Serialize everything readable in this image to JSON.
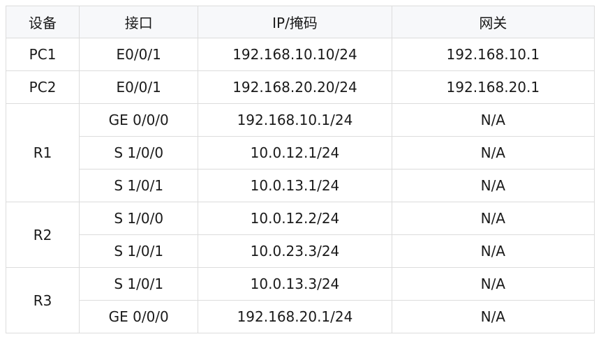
{
  "table": {
    "headers": {
      "device": "设备",
      "interface": "接口",
      "ip_mask": "IP/掩码",
      "gateway": "网关"
    },
    "groups": [
      {
        "device": "PC1",
        "rows": [
          {
            "interface": "E0/0/1",
            "ip": "192.168.10.10/24",
            "gateway": "192.168.10.1"
          }
        ]
      },
      {
        "device": "PC2",
        "rows": [
          {
            "interface": "E0/0/1",
            "ip": "192.168.20.20/24",
            "gateway": "192.168.20.1"
          }
        ]
      },
      {
        "device": "R1",
        "rows": [
          {
            "interface": "GE 0/0/0",
            "ip": "192.168.10.1/24",
            "gateway": "N/A"
          },
          {
            "interface": "S 1/0/0",
            "ip": "10.0.12.1/24",
            "gateway": "N/A"
          },
          {
            "interface": "S 1/0/1",
            "ip": "10.0.13.1/24",
            "gateway": "N/A"
          }
        ]
      },
      {
        "device": "R2",
        "rows": [
          {
            "interface": "S 1/0/0",
            "ip": "10.0.12.2/24",
            "gateway": "N/A"
          },
          {
            "interface": "S 1/0/1",
            "ip": "10.0.23.3/24",
            "gateway": "N/A"
          }
        ]
      },
      {
        "device": "R3",
        "rows": [
          {
            "interface": "S 1/0/1",
            "ip": "10.0.13.3/24",
            "gateway": "N/A"
          },
          {
            "interface": "GE 0/0/0",
            "ip": "192.168.20.1/24",
            "gateway": "N/A"
          }
        ]
      }
    ]
  }
}
